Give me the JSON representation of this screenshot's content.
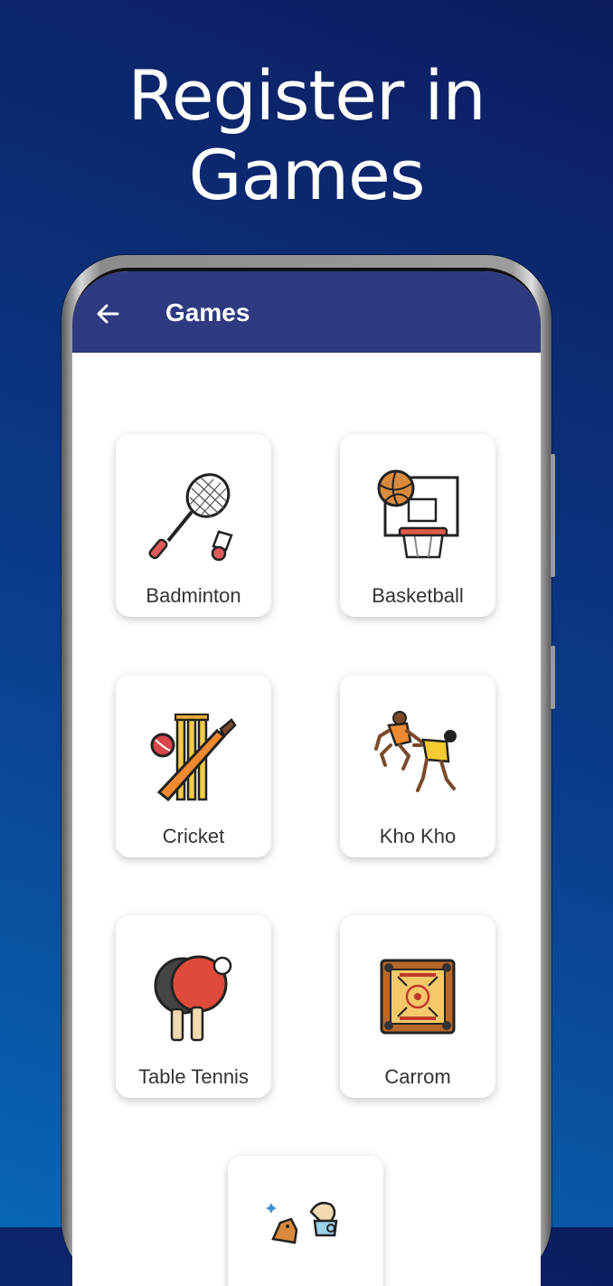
{
  "promo": {
    "line1": "Register in",
    "line2": "Games"
  },
  "appbar": {
    "title": "Games",
    "back_icon": "arrow-left-icon"
  },
  "games": [
    {
      "label": "Badminton",
      "icon": "badminton-icon"
    },
    {
      "label": "Basketball",
      "icon": "basketball-icon"
    },
    {
      "label": "Cricket",
      "icon": "cricket-icon"
    },
    {
      "label": "Kho Kho",
      "icon": "kho-kho-icon"
    },
    {
      "label": "Table Tennis",
      "icon": "table-tennis-icon"
    },
    {
      "label": "Carrom",
      "icon": "carrom-icon"
    },
    {
      "label": "",
      "icon": "chess-icon"
    }
  ],
  "colors": {
    "appbar": "#2e3a7f",
    "background_top": "#0c1c5e",
    "background_bottom": "#0866b4"
  }
}
